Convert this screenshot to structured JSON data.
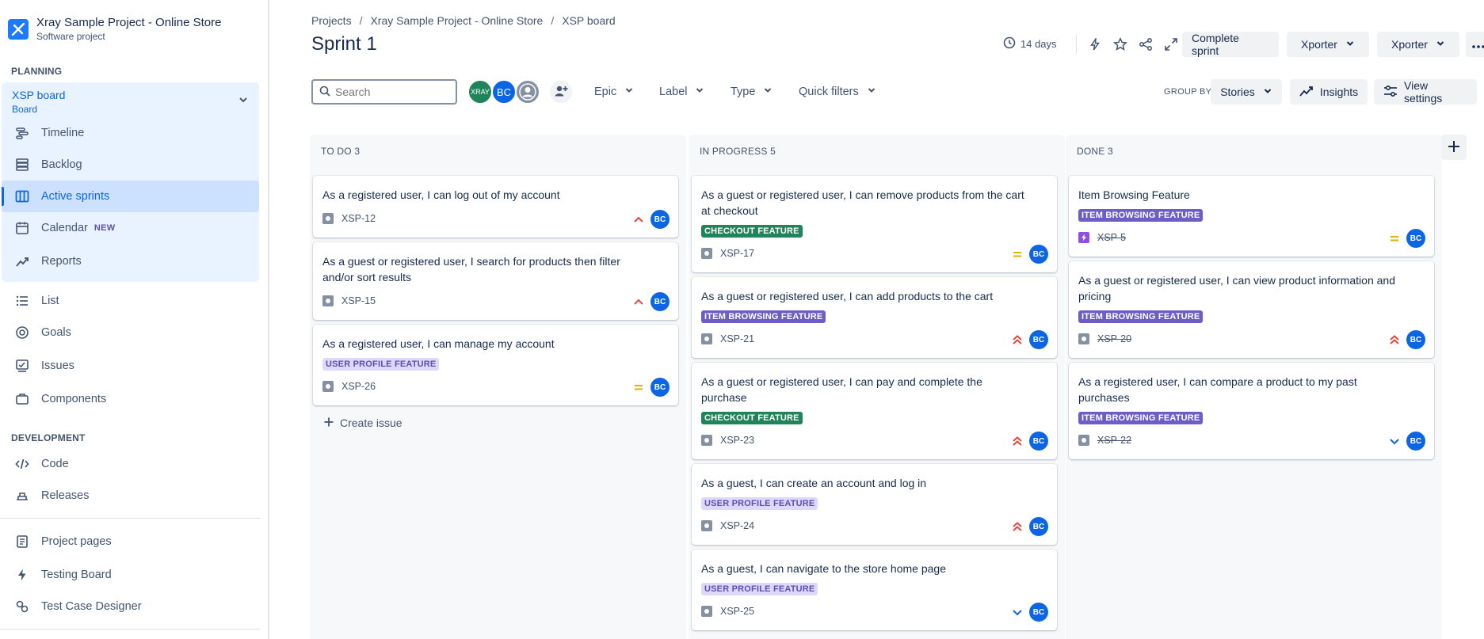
{
  "project": {
    "name": "Xray Sample Project - Online Store",
    "type": "Software project"
  },
  "sidebar": {
    "planning_label": "PLANNING",
    "board": {
      "title": "XSP board",
      "subtitle": "Board"
    },
    "planning_items": [
      {
        "label": "Timeline",
        "icon": "timeline-icon"
      },
      {
        "label": "Backlog",
        "icon": "backlog-icon"
      },
      {
        "label": "Active sprints",
        "icon": "board-icon"
      },
      {
        "label": "Calendar",
        "icon": "calendar-icon",
        "badge": "NEW"
      },
      {
        "label": "Reports",
        "icon": "reports-icon"
      }
    ],
    "other_items": [
      {
        "label": "List",
        "icon": "list-icon"
      },
      {
        "label": "Goals",
        "icon": "goals-icon"
      },
      {
        "label": "Issues",
        "icon": "issues-icon"
      },
      {
        "label": "Components",
        "icon": "components-icon"
      }
    ],
    "development_label": "DEVELOPMENT",
    "dev_items": [
      {
        "label": "Code",
        "icon": "code-icon"
      },
      {
        "label": "Releases",
        "icon": "releases-icon"
      }
    ],
    "app_items": [
      {
        "label": "Project pages",
        "icon": "pages-icon"
      },
      {
        "label": "Testing Board",
        "icon": "lightning-icon"
      },
      {
        "label": "Test Case Designer",
        "icon": "designer-icon"
      }
    ]
  },
  "header": {
    "breadcrumb": [
      "Projects",
      "Xray Sample Project - Online Store",
      "XSP board"
    ],
    "title": "Sprint 1",
    "days_left": "14 days",
    "complete_sprint": "Complete sprint",
    "xporter_1": "Xporter",
    "xporter_2": "Xporter"
  },
  "filters": {
    "search_placeholder": "Search",
    "avatars": [
      "XRAY",
      "BC"
    ],
    "epic": "Epic",
    "label": "Label",
    "type": "Type",
    "quick_filters": "Quick filters",
    "group_by_label": "GROUP BY",
    "group_by_value": "Stories",
    "insights": "Insights",
    "view_settings": "View settings"
  },
  "columns": [
    {
      "header": "TO DO 3",
      "create_issue": "Create issue",
      "cards": [
        {
          "title": "As a registered user, I can log out of my account",
          "tag": "",
          "key": "XSP-12",
          "priority": "medium-high",
          "assignee": "BC"
        },
        {
          "title": "As a guest or registered user, I search for products then filter and/or sort results",
          "tag": "",
          "key": "XSP-15",
          "priority": "medium-high",
          "assignee": "BC"
        },
        {
          "title": "As a registered user, I can manage my account",
          "tag": "USER PROFILE FEATURE",
          "key": "XSP-26",
          "priority": "medium",
          "assignee": "BC"
        }
      ]
    },
    {
      "header": "IN PROGRESS 5",
      "cards": [
        {
          "title": "As a guest or registered user, I can remove products from the cart at checkout",
          "tag": "CHECKOUT FEATURE",
          "key": "XSP-17",
          "priority": "medium",
          "assignee": "BC"
        },
        {
          "title": "As a guest or registered user, I can add products to the cart",
          "tag": "ITEM BROWSING FEATURE",
          "key": "XSP-21",
          "priority": "high",
          "assignee": "BC"
        },
        {
          "title": "As a guest or registered user, I can pay and complete the purchase",
          "tag": "CHECKOUT FEATURE",
          "key": "XSP-23",
          "priority": "high",
          "assignee": "BC"
        },
        {
          "title": "As a guest, I can create an account and log in",
          "tag": "USER PROFILE FEATURE",
          "key": "XSP-24",
          "priority": "high",
          "assignee": "BC"
        },
        {
          "title": "As a guest, I can navigate to the store home page",
          "tag": "USER PROFILE FEATURE",
          "key": "XSP-25",
          "priority": "low",
          "assignee": "BC"
        }
      ]
    },
    {
      "header": "DONE 3",
      "cards": [
        {
          "title": "Item Browsing Feature",
          "tag": "ITEM BROWSING FEATURE",
          "key": "XSP-5",
          "priority": "medium",
          "assignee": "BC",
          "epic": true
        },
        {
          "title": "As a guest or registered user, I can view product information and pricing",
          "tag": "ITEM BROWSING FEATURE",
          "key": "XSP-20",
          "priority": "high",
          "assignee": "BC"
        },
        {
          "title": "As a registered user, I can compare a product to my past purchases",
          "tag": "ITEM BROWSING FEATURE",
          "key": "XSP-22",
          "priority": "low",
          "assignee": "BC"
        }
      ]
    }
  ],
  "colors": {
    "accent": "#0c66e4",
    "checkout_tag": "#1f845a",
    "browsing_tag": "#6e5dc6",
    "profile_tag_bg": "#dfd8fd",
    "priority_high": "#e2483d",
    "priority_medium": "#e2b203",
    "priority_low": "#0c66e4"
  }
}
